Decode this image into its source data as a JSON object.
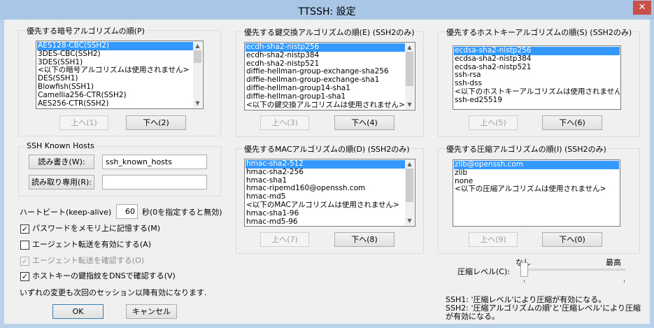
{
  "window": {
    "title": "TTSSH: 設定",
    "close": "✕"
  },
  "cipher": {
    "label": "優先する暗号アルゴリズムの順(P)",
    "items": [
      "AES128-CBC(SSH2)",
      "3DES-CBC(SSH2)",
      "3DES(SSH1)",
      "<以下の暗号アルゴリズムは使用されません>",
      "DES(SSH1)",
      "Blowfish(SSH1)",
      "Camellia256-CTR(SSH2)",
      "AES256-CTR(SSH2)"
    ],
    "selected": 0,
    "thumb": 0.25,
    "up": "上へ(1)",
    "down": "下へ(2)"
  },
  "kex": {
    "label": "優先する鍵交換アルゴリズムの順(E) (SSH2のみ)",
    "items": [
      "ecdh-sha2-nistp256",
      "ecdh-sha2-nistp384",
      "ecdh-sha2-nistp521",
      "diffie-hellman-group-exchange-sha256",
      "diffie-hellman-group-exchange-sha1",
      "diffie-hellman-group14-sha1",
      "diffie-hellman-group1-sha1",
      "<以下の鍵交換アルゴリズムは使用されません>"
    ],
    "selected": 0,
    "thumb": 0.7,
    "up": "上へ(3)",
    "down": "下へ(4)"
  },
  "hostkey": {
    "label": "優先するホストキーアルゴリズムの順(S) (SSH2のみ)",
    "items": [
      "ecdsa-sha2-nistp256",
      "ecdsa-sha2-nistp384",
      "ecdsa-sha2-nistp521",
      "ssh-rsa",
      "ssh-dss",
      "<以下のホストキーアルゴリズムは使用されません>",
      "ssh-ed25519"
    ],
    "selected": 0,
    "up": "上へ(5)",
    "down": "下へ(6)"
  },
  "mac": {
    "label": "優先するMACアルゴリズムの順(D) (SSH2のみ)",
    "items": [
      "hmac-sha2-512",
      "hmac-sha2-256",
      "hmac-sha1",
      "hmac-ripemd160@openssh.com",
      "hmac-md5",
      "<以下のMACアルゴリズムは使用されません>",
      "hmac-sha1-96",
      "hmac-md5-96"
    ],
    "selected": 0,
    "thumb": 0.7,
    "up": "上へ(7)",
    "down": "下へ(8)"
  },
  "compression": {
    "label": "優先する圧縮アルゴリズムの順(I) (SSH2のみ)",
    "items": [
      "zlib@openssh.com",
      "zlib",
      "none",
      "<以下の圧縮アルゴリズムは使用されません>"
    ],
    "selected": 0,
    "up": "上へ(9)",
    "down": "下へ(0)"
  },
  "known_hosts": {
    "label": "SSH Known Hosts",
    "rw_button": "読み書き(W):",
    "rw_value": "ssh_known_hosts",
    "ro_button": "読み取り専用(R):",
    "ro_value": ""
  },
  "heartbeat": {
    "label": "ハートビート(keep-alive)",
    "value": "60",
    "suffix": "秒(0を指定すると無効)"
  },
  "options": [
    {
      "label": "パスワードをメモリ上に記憶する(M)",
      "checked": true,
      "enabled": true
    },
    {
      "label": "エージェント転送を有効にする(A)",
      "checked": false,
      "enabled": true
    },
    {
      "label": "エージェント転送を確認する(O)",
      "checked": true,
      "enabled": false
    },
    {
      "label": "ホストキーの鍵指紋をDNSで確認する(V)",
      "checked": true,
      "enabled": true
    }
  ],
  "note": "いずれの変更も次回のセッション以降有効になります.",
  "ok": "OK",
  "cancel": "キャンセル",
  "compression_level": {
    "label": "圧縮レベル(C):",
    "min_label": "なし",
    "max_label": "最高",
    "value": 0
  },
  "info": {
    "line1": "SSH1: '圧縮レベル'により圧縮が有効になる。",
    "line2": "SSH2: '圧縮アルゴリズムの順'と'圧縮レベル'により圧縮",
    "line3": "が有効になる。"
  }
}
